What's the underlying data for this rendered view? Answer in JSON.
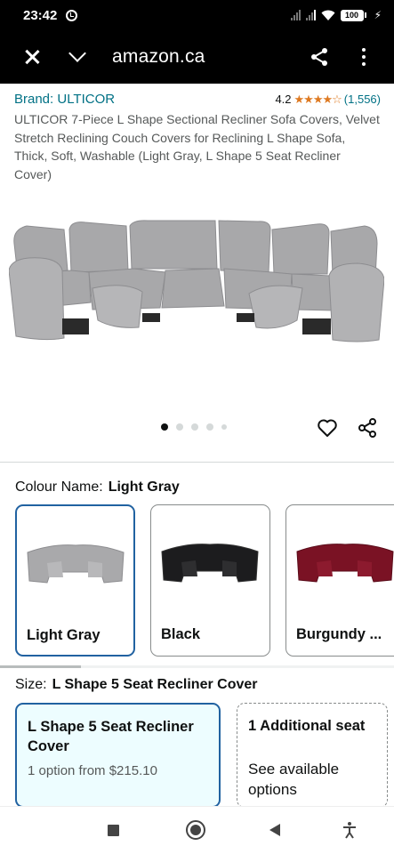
{
  "status_bar": {
    "time": "23:42",
    "battery": "100",
    "bolt": "⚡"
  },
  "browser": {
    "url": "amazon.ca"
  },
  "product": {
    "brand": "Brand: ULTICOR",
    "rating": "4.2",
    "stars": "★★★★☆",
    "rating_count": "(1,556)",
    "title": "ULTICOR 7-Piece L Shape Sectional Recliner Sofa Covers, Velvet Stretch Reclining Couch Covers for Reclining L Shape Sofa, Thick, Soft, Washable (Light Gray, L Shape 5 Seat Recliner Cover)",
    "image_dots": 5,
    "active_image": 1
  },
  "colour": {
    "label": "Colour Name:",
    "selected": "Light Gray",
    "options": [
      {
        "label": "Light Gray",
        "color": "#a9a9ab"
      },
      {
        "label": "Black",
        "color": "#1c1c1e"
      },
      {
        "label": "Burgundy ...",
        "color": "#7a1224"
      }
    ]
  },
  "size": {
    "label": "Size:",
    "selected": "L Shape 5 Seat Recliner Cover",
    "options": [
      {
        "title": "L Shape 5 Seat Recliner Cover",
        "sub": "1 option from $215.10"
      },
      {
        "title": "1 Additional seat",
        "sub": "See available options"
      }
    ]
  },
  "colors": {
    "link": "#007185",
    "star": "#de7921",
    "selected_border": "#2162a1",
    "selected_bg": "#edfdff"
  }
}
